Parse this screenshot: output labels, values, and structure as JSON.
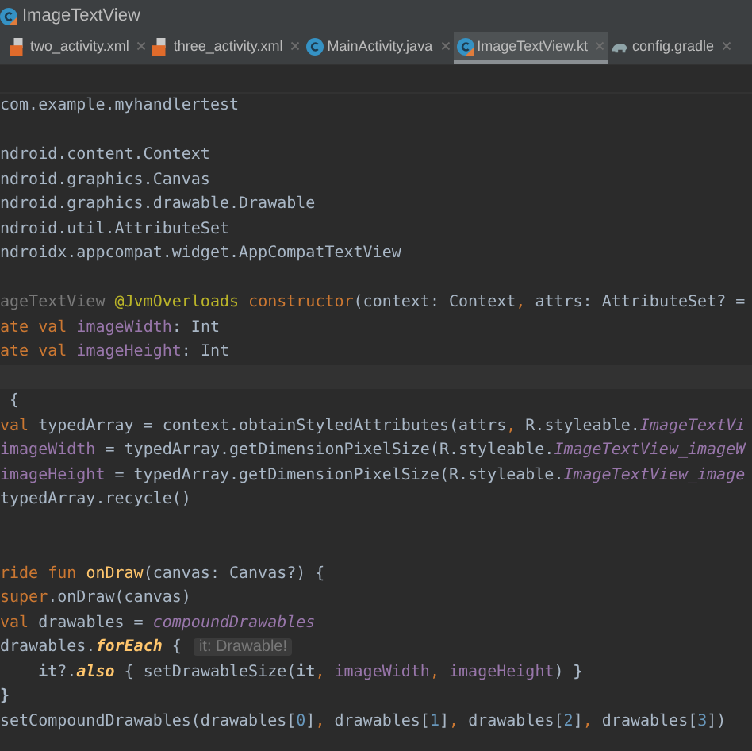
{
  "window": {
    "title": "ImageTextView"
  },
  "tabs": [
    {
      "label": "two_activity.xml",
      "kind": "xml",
      "selected": false
    },
    {
      "label": "three_activity.xml",
      "kind": "xml",
      "selected": false
    },
    {
      "label": "MainActivity.java",
      "kind": "java",
      "selected": false
    },
    {
      "label": "ImageTextView.kt",
      "kind": "kotlin",
      "selected": true
    },
    {
      "label": "config.gradle",
      "kind": "gradle",
      "selected": false
    }
  ],
  "editor": {
    "lines": [
      {
        "kind": "code",
        "tokens": [
          {
            "kind": "plain",
            "text": "com.example.myhandlertest"
          }
        ]
      },
      {
        "kind": "blank"
      },
      {
        "kind": "code",
        "tokens": [
          {
            "kind": "plain",
            "text": "ndroid.content.Context"
          }
        ]
      },
      {
        "kind": "code",
        "tokens": [
          {
            "kind": "plain",
            "text": "ndroid.graphics.Canvas"
          }
        ]
      },
      {
        "kind": "code",
        "tokens": [
          {
            "kind": "plain",
            "text": "ndroid.graphics.drawable.Drawable"
          }
        ]
      },
      {
        "kind": "code",
        "tokens": [
          {
            "kind": "plain",
            "text": "ndroid.util.AttributeSet"
          }
        ]
      },
      {
        "kind": "code",
        "tokens": [
          {
            "kind": "plain",
            "text": "ndroidx.appcompat.widget.AppCompatTextView"
          }
        ]
      },
      {
        "kind": "blank"
      },
      {
        "kind": "code",
        "tokens": [
          {
            "kind": "dim",
            "text": "ageTextView "
          },
          {
            "kind": "annotation",
            "text": "@JvmOverloads "
          },
          {
            "kind": "keyword",
            "text": "constructor"
          },
          {
            "kind": "plain",
            "text": "(context: Context"
          },
          {
            "kind": "keyword",
            "text": ", "
          },
          {
            "kind": "plain",
            "text": "attrs: AttributeSet? ="
          }
        ]
      },
      {
        "kind": "code",
        "tokens": [
          {
            "kind": "keyword",
            "text": "ate val "
          },
          {
            "kind": "field",
            "text": "imageWidth"
          },
          {
            "kind": "plain",
            "text": ": Int"
          }
        ]
      },
      {
        "kind": "code",
        "tokens": [
          {
            "kind": "keyword",
            "text": "ate val "
          },
          {
            "kind": "field",
            "text": "imageHeight"
          },
          {
            "kind": "plain",
            "text": ": Int"
          }
        ]
      },
      {
        "kind": "caret"
      },
      {
        "kind": "code",
        "tokens": [
          {
            "kind": "plain",
            "text": " {"
          }
        ]
      },
      {
        "kind": "code",
        "tokens": [
          {
            "kind": "keyword",
            "text": "val "
          },
          {
            "kind": "plain",
            "text": "typedArray = context.obtainStyledAttributes(attrs"
          },
          {
            "kind": "keyword",
            "text": ", "
          },
          {
            "kind": "plain",
            "text": "R.styleable."
          },
          {
            "kind": "static",
            "text": "ImageTextVi"
          }
        ]
      },
      {
        "kind": "code",
        "tokens": [
          {
            "kind": "field",
            "text": "imageWidth "
          },
          {
            "kind": "plain",
            "text": "= typedArray.getDimensionPixelSize(R.styleable."
          },
          {
            "kind": "static",
            "text": "ImageTextView_imageW"
          }
        ]
      },
      {
        "kind": "code",
        "tokens": [
          {
            "kind": "field",
            "text": "imageHeight "
          },
          {
            "kind": "plain",
            "text": "= typedArray.getDimensionPixelSize(R.styleable."
          },
          {
            "kind": "static",
            "text": "ImageTextView_image"
          }
        ]
      },
      {
        "kind": "code",
        "tokens": [
          {
            "kind": "plain",
            "text": "typedArray.recycle()"
          }
        ]
      },
      {
        "kind": "blank"
      },
      {
        "kind": "blank"
      },
      {
        "kind": "code",
        "tokens": [
          {
            "kind": "keyword",
            "text": "ride fun "
          },
          {
            "kind": "function",
            "text": "onDraw"
          },
          {
            "kind": "plain",
            "text": "(canvas: Canvas?) {"
          }
        ]
      },
      {
        "kind": "code",
        "tokens": [
          {
            "kind": "keyword",
            "text": "super"
          },
          {
            "kind": "plain",
            "text": ".onDraw(canvas)"
          }
        ]
      },
      {
        "kind": "code",
        "tokens": [
          {
            "kind": "keyword",
            "text": "val "
          },
          {
            "kind": "plain",
            "text": "drawables = "
          },
          {
            "kind": "static",
            "text": "compoundDrawables"
          }
        ]
      },
      {
        "kind": "code",
        "tokens": [
          {
            "kind": "plain",
            "text": "drawables."
          },
          {
            "kind": "extension",
            "text": "forEach"
          },
          {
            "kind": "plain",
            "text": " { "
          },
          {
            "kind": "hint",
            "text": "it: Drawable!"
          }
        ]
      },
      {
        "kind": "code",
        "tokens": [
          {
            "kind": "bold",
            "text": "    it"
          },
          {
            "kind": "plain",
            "text": "?."
          },
          {
            "kind": "extension",
            "text": "also"
          },
          {
            "kind": "plain",
            "text": " { setDrawableSize("
          },
          {
            "kind": "bold",
            "text": "it"
          },
          {
            "kind": "keyword",
            "text": ", "
          },
          {
            "kind": "field",
            "text": "imageWidth"
          },
          {
            "kind": "keyword",
            "text": ", "
          },
          {
            "kind": "field",
            "text": "imageHeight"
          },
          {
            "kind": "plain",
            "text": ") "
          },
          {
            "kind": "bold",
            "text": "}"
          }
        ]
      },
      {
        "kind": "code",
        "tokens": [
          {
            "kind": "bold",
            "text": "}"
          }
        ]
      },
      {
        "kind": "code",
        "tokens": [
          {
            "kind": "plain",
            "text": "setCompoundDrawables(drawables["
          },
          {
            "kind": "number",
            "text": "0"
          },
          {
            "kind": "plain",
            "text": "]"
          },
          {
            "kind": "keyword",
            "text": ", "
          },
          {
            "kind": "plain",
            "text": "drawables["
          },
          {
            "kind": "number",
            "text": "1"
          },
          {
            "kind": "plain",
            "text": "]"
          },
          {
            "kind": "keyword",
            "text": ", "
          },
          {
            "kind": "plain",
            "text": "drawables["
          },
          {
            "kind": "number",
            "text": "2"
          },
          {
            "kind": "plain",
            "text": "]"
          },
          {
            "kind": "keyword",
            "text": ", "
          },
          {
            "kind": "plain",
            "text": "drawables["
          },
          {
            "kind": "number",
            "text": "3"
          },
          {
            "kind": "plain",
            "text": "])"
          }
        ]
      }
    ]
  }
}
